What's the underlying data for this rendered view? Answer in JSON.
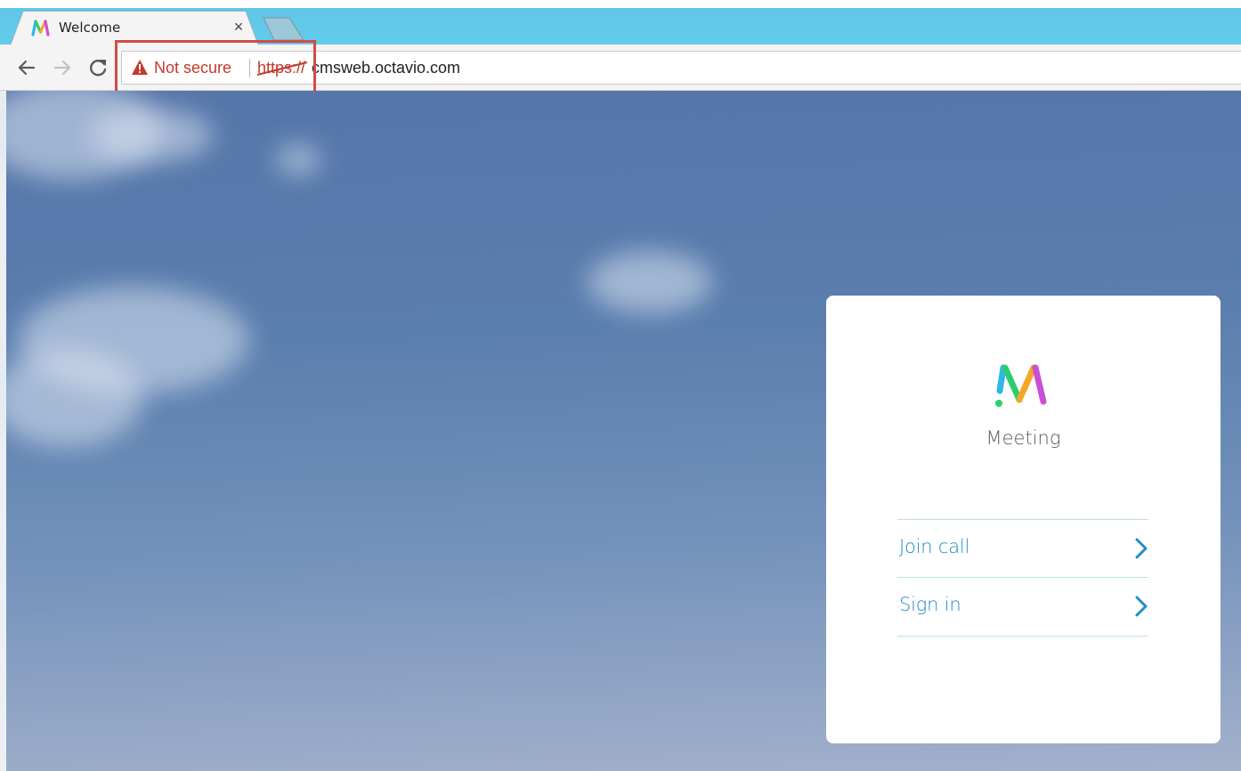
{
  "browser": {
    "tab": {
      "title": "Welcome",
      "close_glyph": "×",
      "favicon": "meeting-logo-icon"
    },
    "toolbar": {
      "back_icon": "arrow-left-icon",
      "forward_icon": "arrow-right-icon",
      "reload_icon": "reload-icon",
      "security_icon": "warning-triangle-icon",
      "security_label": "Not secure",
      "scheme": "https://",
      "host": "cmsweb.octavio.com"
    }
  },
  "card": {
    "logo": "meeting-logo-icon",
    "app_name": "Meeting",
    "menu": [
      {
        "label": "Join call",
        "icon": "chevron-right-icon"
      },
      {
        "label": "Sign in",
        "icon": "chevron-right-icon"
      }
    ]
  },
  "colors": {
    "tabstrip": "#63cbec",
    "warning": "#c5392c",
    "highlight": "#d24b45",
    "link": "#1f8ec7",
    "divider": "#bfe0ea",
    "sky": "#5a7eae"
  }
}
